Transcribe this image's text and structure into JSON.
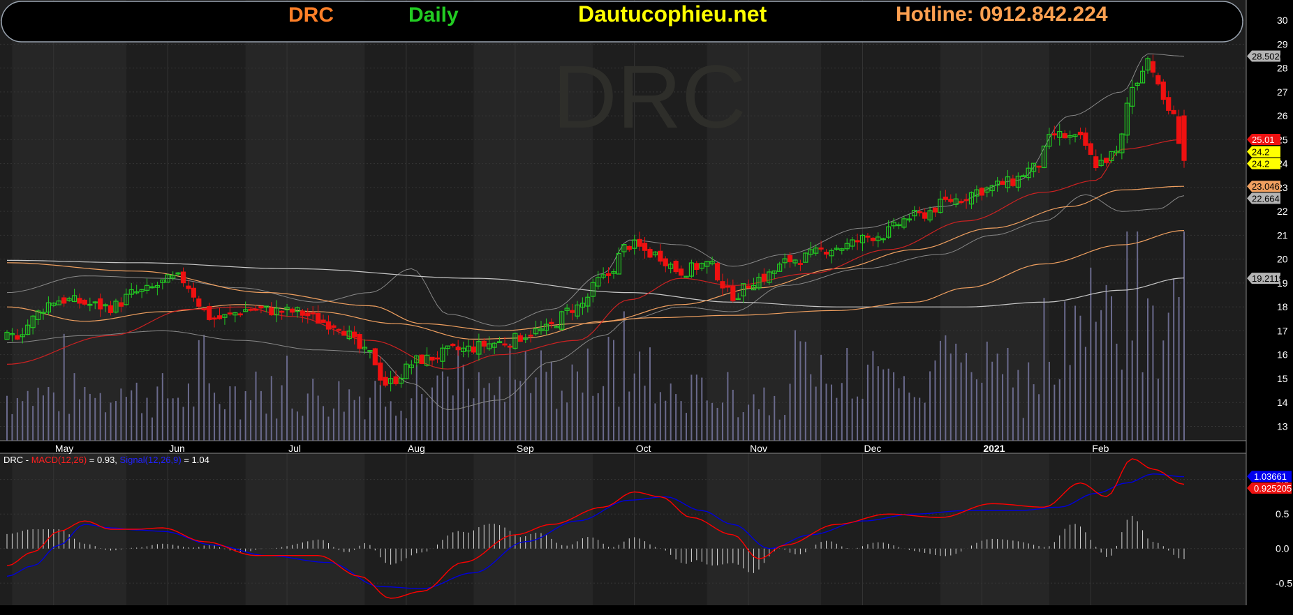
{
  "banner": {
    "symbol": "DRC",
    "period": "Daily",
    "site": "Dautucophieu.net",
    "hotline": "Hotline: 0912.842.224"
  },
  "watermark": "DRC",
  "colors": {
    "background": "#1e1e1e",
    "up": "#22cc22",
    "down": "#ee1111",
    "volume": "#6a6a8c",
    "symbol_text": "#ff7f27",
    "period_text": "#22cc22",
    "site_text": "#ffff00",
    "hotline_text": "#ffa050",
    "macd_line": "#ff0000",
    "signal_line": "#0000dd"
  },
  "chart_data": [
    {
      "type": "candlestick",
      "title": "",
      "x_month_labels": [
        "May",
        "Jun",
        "Jul",
        "Aug",
        "Sep",
        "Oct",
        "Nov",
        "Dec",
        "2021",
        "Feb"
      ],
      "y_ticks": [
        13,
        14,
        15,
        16,
        17,
        18,
        19,
        20,
        21,
        22,
        23,
        24,
        25,
        26,
        27,
        28,
        29,
        30
      ],
      "ylim": [
        12.4,
        30.5
      ],
      "price_tags": [
        {
          "text": "28.5026",
          "value": 28.5,
          "bg": "#b4b4b4",
          "fg": "#000000"
        },
        {
          "text": "25.01",
          "value": 25.01,
          "bg": "#ee1111",
          "fg": "#ffffff"
        },
        {
          "text": "24.2",
          "value": 24.5,
          "bg": "#ffff00",
          "fg": "#000000"
        },
        {
          "text": "24.2",
          "value": 24.0,
          "bg": "#ffff00",
          "fg": "#000000"
        },
        {
          "text": "23.046",
          "value": 23.05,
          "bg": "#f0a060",
          "fg": "#000000"
        },
        {
          "text": "22.664",
          "value": 22.55,
          "bg": "#b4b4b4",
          "fg": "#000000"
        },
        {
          "text": "19.2119",
          "value": 19.2,
          "bg": "#b4b4b4",
          "fg": "#000000"
        }
      ],
      "series": [
        {
          "name": "MA 200",
          "color": "#c8c8c8",
          "anchors": [
            [
              0,
              19.95
            ],
            [
              25,
              19.85
            ],
            [
              55,
              19.6
            ],
            [
              90,
              19.2
            ],
            [
              120,
              18.6
            ],
            [
              140,
              18.2
            ],
            [
              160,
              18.0
            ],
            [
              185,
              18.0
            ],
            [
              200,
              18.2
            ],
            [
              215,
              18.7
            ],
            [
              227,
              19.21
            ]
          ]
        },
        {
          "name": "MA 100",
          "color": "#f0a060",
          "anchors": [
            [
              0,
              19.85
            ],
            [
              25,
              19.5
            ],
            [
              50,
              18.6
            ],
            [
              70,
              18.05
            ],
            [
              80,
              17.3
            ],
            [
              95,
              17.0
            ],
            [
              110,
              17.3
            ],
            [
              125,
              17.55
            ],
            [
              140,
              17.65
            ],
            [
              160,
              17.85
            ],
            [
              175,
              18.2
            ],
            [
              185,
              18.8
            ],
            [
              200,
              19.8
            ],
            [
              215,
              20.6
            ],
            [
              227,
              21.2
            ]
          ]
        },
        {
          "name": "MA 50",
          "color": "#f0a060",
          "anchors": [
            [
              0,
              18.0
            ],
            [
              15,
              17.4
            ],
            [
              30,
              17.8
            ],
            [
              45,
              18.1
            ],
            [
              60,
              17.8
            ],
            [
              75,
              17.3
            ],
            [
              90,
              16.65
            ],
            [
              100,
              16.7
            ],
            [
              115,
              17.4
            ],
            [
              130,
              18.1
            ],
            [
              145,
              18.8
            ],
            [
              160,
              19.6
            ],
            [
              175,
              20.4
            ],
            [
              190,
              21.3
            ],
            [
              205,
              22.2
            ],
            [
              215,
              22.9
            ],
            [
              227,
              23.05
            ]
          ]
        }
      ],
      "bollinger": {
        "color": "#888888",
        "upper_anchors": [
          [
            0,
            18.6
          ],
          [
            15,
            19.3
          ],
          [
            30,
            19.2
          ],
          [
            45,
            18.8
          ],
          [
            60,
            18.2
          ],
          [
            70,
            18.6
          ],
          [
            78,
            19.6
          ],
          [
            85,
            17.7
          ],
          [
            95,
            17.2
          ],
          [
            105,
            17.9
          ],
          [
            115,
            19.4
          ],
          [
            120,
            20.8
          ],
          [
            130,
            20.6
          ],
          [
            140,
            19.7
          ],
          [
            150,
            20.2
          ],
          [
            165,
            21.3
          ],
          [
            180,
            22.2
          ],
          [
            195,
            23.3
          ],
          [
            205,
            26.0
          ],
          [
            215,
            27.0
          ],
          [
            220,
            28.6
          ],
          [
            227,
            28.5
          ]
        ],
        "lower_anchors": [
          [
            0,
            16.5
          ],
          [
            15,
            16.8
          ],
          [
            30,
            17.0
          ],
          [
            45,
            16.6
          ],
          [
            60,
            16.2
          ],
          [
            70,
            16.1
          ],
          [
            78,
            14.8
          ],
          [
            85,
            13.7
          ],
          [
            95,
            14.1
          ],
          [
            105,
            15.7
          ],
          [
            115,
            16.8
          ],
          [
            120,
            17.5
          ],
          [
            130,
            18.0
          ],
          [
            140,
            17.8
          ],
          [
            150,
            18.9
          ],
          [
            165,
            19.6
          ],
          [
            180,
            20.2
          ],
          [
            190,
            21.0
          ],
          [
            200,
            21.6
          ],
          [
            208,
            22.7
          ],
          [
            215,
            22.0
          ],
          [
            222,
            22.1
          ],
          [
            227,
            22.66
          ]
        ]
      },
      "ema_fast": {
        "color": "#cc2222",
        "anchors": [
          [
            0,
            15.6
          ],
          [
            20,
            16.8
          ],
          [
            35,
            17.9
          ],
          [
            45,
            18.0
          ],
          [
            55,
            17.6
          ],
          [
            70,
            16.6
          ],
          [
            85,
            15.4
          ],
          [
            95,
            16.0
          ],
          [
            110,
            16.6
          ],
          [
            120,
            18.3
          ],
          [
            130,
            19.2
          ],
          [
            140,
            18.9
          ],
          [
            155,
            19.4
          ],
          [
            170,
            20.4
          ],
          [
            185,
            21.6
          ],
          [
            200,
            22.8
          ],
          [
            210,
            23.3
          ],
          [
            215,
            24.6
          ],
          [
            227,
            25.01
          ]
        ]
      },
      "close_anchors": [
        [
          0,
          16.7
        ],
        [
          10,
          18.3
        ],
        [
          20,
          18.0
        ],
        [
          25,
          18.6
        ],
        [
          33,
          19.2
        ],
        [
          40,
          17.5
        ],
        [
          47,
          17.9
        ],
        [
          55,
          17.8
        ],
        [
          63,
          17.3
        ],
        [
          70,
          16.0
        ],
        [
          73,
          14.8
        ],
        [
          80,
          15.8
        ],
        [
          87,
          16.2
        ],
        [
          95,
          16.5
        ],
        [
          103,
          17.0
        ],
        [
          110,
          18.0
        ],
        [
          115,
          19.2
        ],
        [
          120,
          20.6
        ],
        [
          125,
          20.2
        ],
        [
          130,
          19.5
        ],
        [
          135,
          19.8
        ],
        [
          140,
          18.5
        ],
        [
          145,
          19.2
        ],
        [
          152,
          20.0
        ],
        [
          160,
          20.5
        ],
        [
          168,
          21.0
        ],
        [
          175,
          21.8
        ],
        [
          183,
          22.5
        ],
        [
          188,
          22.9
        ],
        [
          193,
          23.2
        ],
        [
          198,
          23.8
        ],
        [
          202,
          25.2
        ],
        [
          207,
          25.0
        ],
        [
          210,
          24.0
        ],
        [
          214,
          24.4
        ],
        [
          217,
          27.2
        ],
        [
          220,
          28.4
        ],
        [
          223,
          26.7
        ],
        [
          225,
          25.9
        ],
        [
          227,
          24.2
        ]
      ],
      "candle_count": 228,
      "volume_heights": []
    },
    {
      "type": "line",
      "title": "",
      "legend": {
        "prefix": "DRC - ",
        "macd": "MACD(12,26)",
        "macd_val": " = 0.93, ",
        "signal": "Signal(12,26,9)",
        "signal_val": " = 1.04"
      },
      "y_ticks": [
        -0.5,
        0.0,
        0.5,
        1.0
      ],
      "ylim": [
        -0.82,
        1.38
      ],
      "tags": [
        {
          "text": "1.03661",
          "value": 1.045,
          "bg": "#0000ee",
          "fg": "#ffffff"
        },
        {
          "text": "0.925205",
          "value": 0.875,
          "bg": "#ee1111",
          "fg": "#ffffff"
        }
      ],
      "macd_anchors": [
        [
          0,
          -0.25
        ],
        [
          5,
          -0.05
        ],
        [
          10,
          0.25
        ],
        [
          15,
          0.4
        ],
        [
          20,
          0.28
        ],
        [
          25,
          0.28
        ],
        [
          30,
          0.3
        ],
        [
          38,
          0.1
        ],
        [
          48,
          -0.1
        ],
        [
          60,
          -0.1
        ],
        [
          68,
          -0.4
        ],
        [
          74,
          -0.72
        ],
        [
          80,
          -0.62
        ],
        [
          88,
          -0.2
        ],
        [
          98,
          0.2
        ],
        [
          105,
          0.35
        ],
        [
          115,
          0.6
        ],
        [
          121,
          0.82
        ],
        [
          126,
          0.75
        ],
        [
          132,
          0.45
        ],
        [
          140,
          0.2
        ],
        [
          145,
          -0.15
        ],
        [
          150,
          0.05
        ],
        [
          160,
          0.35
        ],
        [
          170,
          0.5
        ],
        [
          180,
          0.45
        ],
        [
          190,
          0.65
        ],
        [
          200,
          0.6
        ],
        [
          207,
          0.95
        ],
        [
          212,
          0.75
        ],
        [
          217,
          1.3
        ],
        [
          221,
          1.15
        ],
        [
          227,
          0.93
        ]
      ],
      "signal_anchors": [
        [
          0,
          -0.4
        ],
        [
          5,
          -0.25
        ],
        [
          10,
          0.05
        ],
        [
          15,
          0.35
        ],
        [
          20,
          0.3
        ],
        [
          25,
          0.27
        ],
        [
          30,
          0.25
        ],
        [
          40,
          0.05
        ],
        [
          50,
          -0.1
        ],
        [
          62,
          -0.2
        ],
        [
          72,
          -0.55
        ],
        [
          80,
          -0.58
        ],
        [
          90,
          -0.35
        ],
        [
          100,
          0.1
        ],
        [
          110,
          0.4
        ],
        [
          120,
          0.7
        ],
        [
          127,
          0.75
        ],
        [
          134,
          0.55
        ],
        [
          140,
          0.35
        ],
        [
          147,
          0.0
        ],
        [
          155,
          0.2
        ],
        [
          165,
          0.4
        ],
        [
          175,
          0.5
        ],
        [
          185,
          0.55
        ],
        [
          195,
          0.55
        ],
        [
          203,
          0.6
        ],
        [
          210,
          0.8
        ],
        [
          216,
          0.95
        ],
        [
          221,
          1.08
        ],
        [
          227,
          1.04
        ]
      ]
    }
  ]
}
